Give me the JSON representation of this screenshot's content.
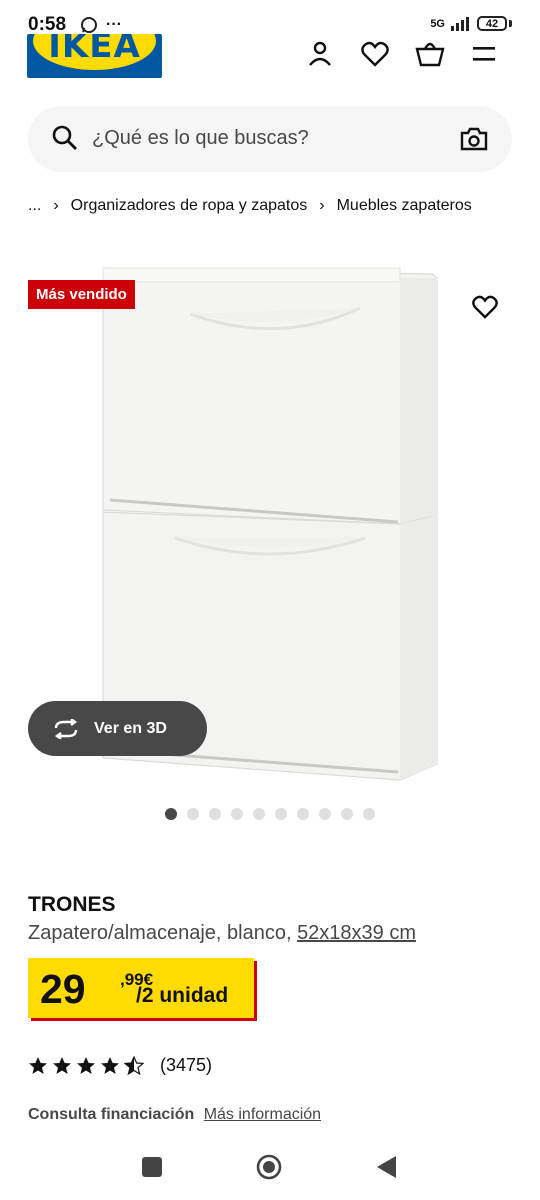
{
  "status_bar": {
    "time": "0:58",
    "network": "5G",
    "battery": "42"
  },
  "header": {
    "logo_text": "IKEA",
    "icons": [
      "user-icon",
      "heart-icon",
      "cart-icon",
      "menu-icon"
    ]
  },
  "search": {
    "placeholder": "¿Qué es lo que buscas?"
  },
  "breadcrumb": {
    "ellipsis": "...",
    "items": [
      "Organizadores de ropa y zapatos",
      "Muebles zapateros"
    ]
  },
  "product_image": {
    "badge": "Más vendido",
    "view_3d_label": "Ver en 3D",
    "image_count": 10,
    "active_image": 1
  },
  "product": {
    "name": "TRONES",
    "description": "Zapatero/almacenaje, blanco,",
    "size": "52x18x39 cm",
    "price_integer": "29",
    "price_decimal": ",99€",
    "price_unit": "/2 unidad",
    "rating_count": "(3475)",
    "rating_stars": 4.5,
    "finance_label": "Consulta financiación",
    "finance_link": "Más información"
  },
  "colors": {
    "ikea_blue": "#0058a3",
    "ikea_yellow": "#ffdb00",
    "badge_red": "#cc0008"
  }
}
